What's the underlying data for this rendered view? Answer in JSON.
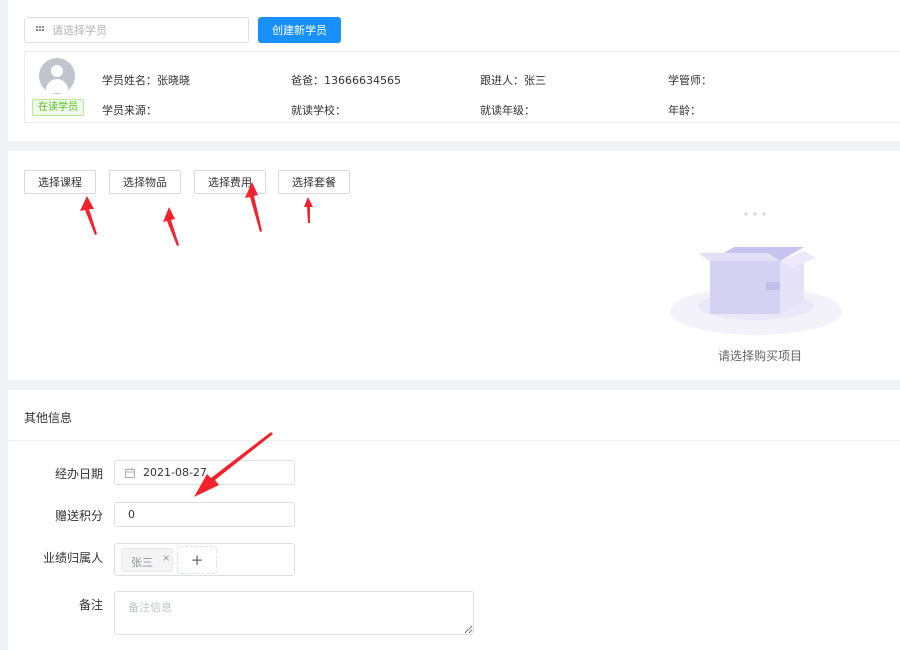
{
  "student_select": {
    "placeholder": "请选择学员",
    "icon": "grid-icon"
  },
  "create_button": "创建新学员",
  "student": {
    "name_label": "学员姓名：",
    "name": "张晓晓",
    "dad_label": "爸爸：",
    "dad_phone": "13666634565",
    "follower_label": "跟进人：",
    "follower": "张三",
    "manager_label": "学管师：",
    "source_label": "学员来源：",
    "school_label": "就读学校：",
    "grade_label": "就读年级：",
    "age_label": "年龄：",
    "status": "在读学员"
  },
  "select_buttons": [
    "选择课程",
    "选择物品",
    "选择费用",
    "选择套餐"
  ],
  "empty_state": {
    "text": "请选择购买项目",
    "icon": "empty-box-icon"
  },
  "other_info": {
    "title": "其他信息",
    "date_label": "经办日期",
    "date_value": "2021-08-27",
    "points_label": "赠送积分",
    "points_value": "0",
    "owner_label": "业绩归属人",
    "owner_tag": "张三",
    "tag_close": "×",
    "add_symbol": "+",
    "remark_label": "备注",
    "remark_placeholder": "备注信息"
  },
  "colors": {
    "primary": "#1890ff",
    "status_green": "#52c41a",
    "annotation_red": "#f5222d"
  }
}
